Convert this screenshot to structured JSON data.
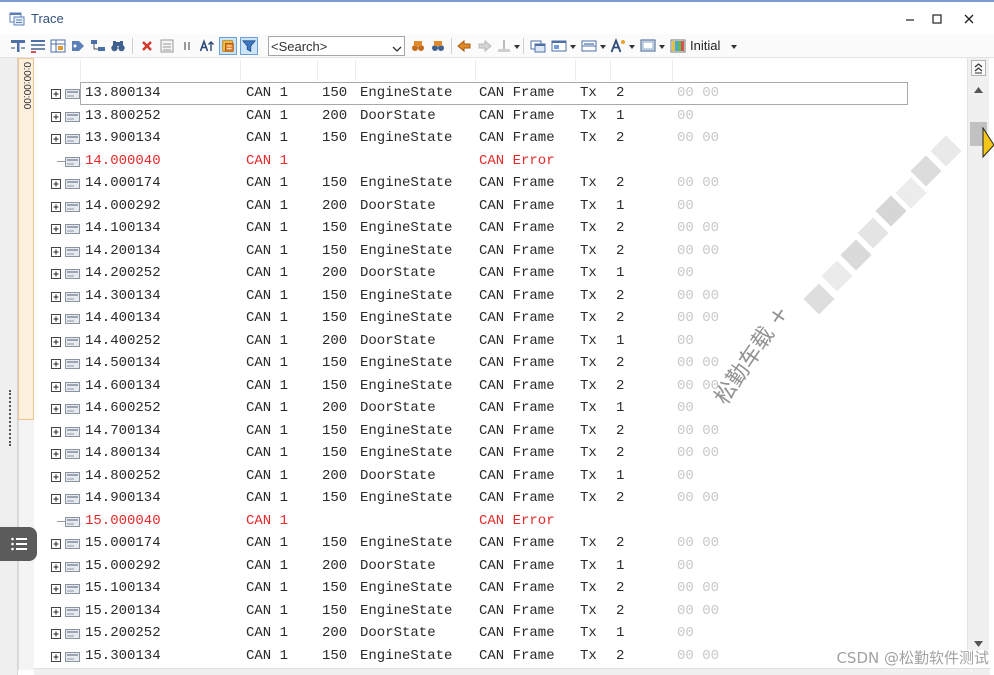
{
  "window": {
    "title": "Trace"
  },
  "toolbar": {
    "search_placeholder": "<Search>",
    "layout_label": "Initial"
  },
  "time_axis": {
    "label": "0:00:00:00"
  },
  "colors": {
    "error": "#e62a2a",
    "data_bytes": "#c8c8c8",
    "text": "#2a2a2a",
    "time_strip": "#f2c48d",
    "pressed_button": "#cde4f7"
  },
  "trace": {
    "rows": [
      {
        "time": "13.800134",
        "channel": "CAN 1",
        "id": "150",
        "name": "EngineState",
        "type": "CAN Frame",
        "dir": "Tx",
        "dlc": "2",
        "data": "00 00",
        "selected": true
      },
      {
        "time": "13.800252",
        "channel": "CAN 1",
        "id": "200",
        "name": "DoorState",
        "type": "CAN Frame",
        "dir": "Tx",
        "dlc": "1",
        "data": "00"
      },
      {
        "time": "13.900134",
        "channel": "CAN 1",
        "id": "150",
        "name": "EngineState",
        "type": "CAN Frame",
        "dir": "Tx",
        "dlc": "2",
        "data": "00 00"
      },
      {
        "time": "14.000040",
        "channel": "CAN 1",
        "type": "CAN Error",
        "error": true
      },
      {
        "time": "14.000174",
        "channel": "CAN 1",
        "id": "150",
        "name": "EngineState",
        "type": "CAN Frame",
        "dir": "Tx",
        "dlc": "2",
        "data": "00 00"
      },
      {
        "time": "14.000292",
        "channel": "CAN 1",
        "id": "200",
        "name": "DoorState",
        "type": "CAN Frame",
        "dir": "Tx",
        "dlc": "1",
        "data": "00"
      },
      {
        "time": "14.100134",
        "channel": "CAN 1",
        "id": "150",
        "name": "EngineState",
        "type": "CAN Frame",
        "dir": "Tx",
        "dlc": "2",
        "data": "00 00"
      },
      {
        "time": "14.200134",
        "channel": "CAN 1",
        "id": "150",
        "name": "EngineState",
        "type": "CAN Frame",
        "dir": "Tx",
        "dlc": "2",
        "data": "00 00"
      },
      {
        "time": "14.200252",
        "channel": "CAN 1",
        "id": "200",
        "name": "DoorState",
        "type": "CAN Frame",
        "dir": "Tx",
        "dlc": "1",
        "data": "00"
      },
      {
        "time": "14.300134",
        "channel": "CAN 1",
        "id": "150",
        "name": "EngineState",
        "type": "CAN Frame",
        "dir": "Tx",
        "dlc": "2",
        "data": "00 00"
      },
      {
        "time": "14.400134",
        "channel": "CAN 1",
        "id": "150",
        "name": "EngineState",
        "type": "CAN Frame",
        "dir": "Tx",
        "dlc": "2",
        "data": "00 00"
      },
      {
        "time": "14.400252",
        "channel": "CAN 1",
        "id": "200",
        "name": "DoorState",
        "type": "CAN Frame",
        "dir": "Tx",
        "dlc": "1",
        "data": "00"
      },
      {
        "time": "14.500134",
        "channel": "CAN 1",
        "id": "150",
        "name": "EngineState",
        "type": "CAN Frame",
        "dir": "Tx",
        "dlc": "2",
        "data": "00 00"
      },
      {
        "time": "14.600134",
        "channel": "CAN 1",
        "id": "150",
        "name": "EngineState",
        "type": "CAN Frame",
        "dir": "Tx",
        "dlc": "2",
        "data": "00 00"
      },
      {
        "time": "14.600252",
        "channel": "CAN 1",
        "id": "200",
        "name": "DoorState",
        "type": "CAN Frame",
        "dir": "Tx",
        "dlc": "1",
        "data": "00"
      },
      {
        "time": "14.700134",
        "channel": "CAN 1",
        "id": "150",
        "name": "EngineState",
        "type": "CAN Frame",
        "dir": "Tx",
        "dlc": "2",
        "data": "00 00"
      },
      {
        "time": "14.800134",
        "channel": "CAN 1",
        "id": "150",
        "name": "EngineState",
        "type": "CAN Frame",
        "dir": "Tx",
        "dlc": "2",
        "data": "00 00"
      },
      {
        "time": "14.800252",
        "channel": "CAN 1",
        "id": "200",
        "name": "DoorState",
        "type": "CAN Frame",
        "dir": "Tx",
        "dlc": "1",
        "data": "00"
      },
      {
        "time": "14.900134",
        "channel": "CAN 1",
        "id": "150",
        "name": "EngineState",
        "type": "CAN Frame",
        "dir": "Tx",
        "dlc": "2",
        "data": "00 00"
      },
      {
        "time": "15.000040",
        "channel": "CAN 1",
        "type": "CAN Error",
        "error": true
      },
      {
        "time": "15.000174",
        "channel": "CAN 1",
        "id": "150",
        "name": "EngineState",
        "type": "CAN Frame",
        "dir": "Tx",
        "dlc": "2",
        "data": "00 00"
      },
      {
        "time": "15.000292",
        "channel": "CAN 1",
        "id": "200",
        "name": "DoorState",
        "type": "CAN Frame",
        "dir": "Tx",
        "dlc": "1",
        "data": "00"
      },
      {
        "time": "15.100134",
        "channel": "CAN 1",
        "id": "150",
        "name": "EngineState",
        "type": "CAN Frame",
        "dir": "Tx",
        "dlc": "2",
        "data": "00 00"
      },
      {
        "time": "15.200134",
        "channel": "CAN 1",
        "id": "150",
        "name": "EngineState",
        "type": "CAN Frame",
        "dir": "Tx",
        "dlc": "2",
        "data": "00 00"
      },
      {
        "time": "15.200252",
        "channel": "CAN 1",
        "id": "200",
        "name": "DoorState",
        "type": "CAN Frame",
        "dir": "Tx",
        "dlc": "1",
        "data": "00"
      },
      {
        "time": "15.300134",
        "channel": "CAN 1",
        "id": "150",
        "name": "EngineState",
        "type": "CAN Frame",
        "dir": "Tx",
        "dlc": "2",
        "data": "00 00"
      }
    ]
  },
  "watermarks": {
    "diagonal": "松勤车载 +",
    "footer": "CSDN @松勤软件测试"
  }
}
